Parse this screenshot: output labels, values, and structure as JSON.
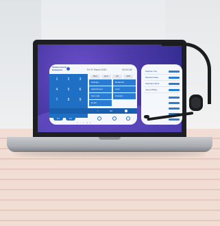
{
  "app": {
    "brand_line1": "Alcatel-Lucent",
    "brand_line2": "Enterprise",
    "date": "Fri 07 March 2030",
    "time": "09:04 AM"
  },
  "keypad": {
    "keys": [
      {
        "digit": "1"
      },
      {
        "digit": "2"
      },
      {
        "digit": "3"
      },
      {
        "digit": "4"
      },
      {
        "digit": "5"
      },
      {
        "digit": "6"
      },
      {
        "digit": "7"
      },
      {
        "digit": "8"
      },
      {
        "digit": "9"
      },
      {
        "digit": "*"
      },
      {
        "digit": "0"
      },
      {
        "digit": "#"
      }
    ]
  },
  "tabs": [
    "Menu",
    "perso",
    "Info",
    "ADD"
  ],
  "menu": {
    "left": [
      "Settings",
      "Appointment",
      "Text mail",
      "Email"
    ],
    "right": [
      "Redial list",
      "Lock",
      "Forward"
    ]
  },
  "call_bar": {
    "ok_label": "OK"
  },
  "footer": {
    "f1": "F1",
    "f2": "F2"
  },
  "contacts": [
    "Stephen Fox",
    "Richard Kelley",
    "Stephane Bock",
    "Jesus Philips"
  ],
  "colors": {
    "accent": "#1f6fc4",
    "screen": "#4c3aa8"
  }
}
